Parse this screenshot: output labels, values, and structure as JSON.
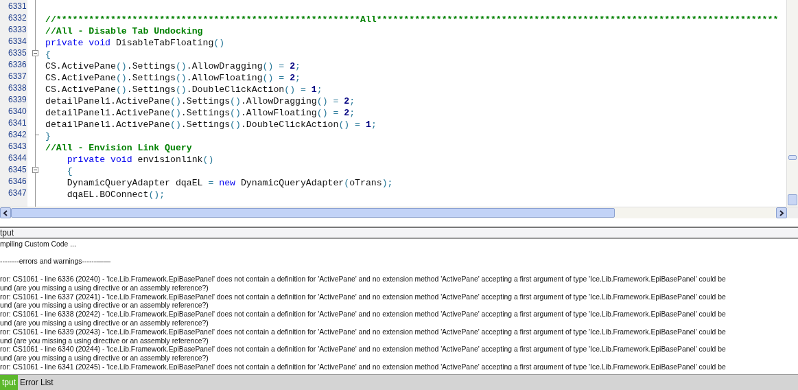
{
  "editor": {
    "lines": [
      {
        "number": "6331",
        "kind": "plain"
      },
      {
        "number": "6332",
        "kind": "plain",
        "tokens": [
          {
            "kind": "comment",
            "text": "//********************************************************All**************************************************************************"
          }
        ]
      },
      {
        "number": "6333",
        "kind": "plain",
        "tokens": [
          {
            "kind": "comment",
            "text": "//All - Disable Tab Undocking"
          }
        ]
      },
      {
        "number": "6334",
        "kind": "plain",
        "tokens": [
          {
            "kind": "keyword",
            "text": "private void "
          },
          {
            "kind": "plain",
            "text": "DisableTabFloating"
          },
          {
            "kind": "punct",
            "text": "()"
          }
        ]
      },
      {
        "number": "6335",
        "kind": "fold-start",
        "tokens": [
          {
            "kind": "punct",
            "text": "{"
          }
        ]
      },
      {
        "number": "6336",
        "kind": "plain",
        "tokens": [
          {
            "kind": "plain",
            "text": "CS.ActivePane"
          },
          {
            "kind": "punct",
            "text": "()"
          },
          {
            "kind": "plain",
            "text": ".Settings"
          },
          {
            "kind": "punct",
            "text": "()"
          },
          {
            "kind": "plain",
            "text": ".AllowDragging"
          },
          {
            "kind": "punct",
            "text": "() = "
          },
          {
            "kind": "number",
            "text": "2"
          },
          {
            "kind": "punct",
            "text": ";"
          }
        ]
      },
      {
        "number": "6337",
        "kind": "plain",
        "tokens": [
          {
            "kind": "plain",
            "text": "CS.ActivePane"
          },
          {
            "kind": "punct",
            "text": "()"
          },
          {
            "kind": "plain",
            "text": ".Settings"
          },
          {
            "kind": "punct",
            "text": "()"
          },
          {
            "kind": "plain",
            "text": ".AllowFloating"
          },
          {
            "kind": "punct",
            "text": "() = "
          },
          {
            "kind": "number",
            "text": "2"
          },
          {
            "kind": "punct",
            "text": ";"
          }
        ]
      },
      {
        "number": "6338",
        "kind": "plain",
        "tokens": [
          {
            "kind": "plain",
            "text": "CS.ActivePane"
          },
          {
            "kind": "punct",
            "text": "()"
          },
          {
            "kind": "plain",
            "text": ".Settings"
          },
          {
            "kind": "punct",
            "text": "()"
          },
          {
            "kind": "plain",
            "text": ".DoubleClickAction"
          },
          {
            "kind": "punct",
            "text": "() = "
          },
          {
            "kind": "number",
            "text": "1"
          },
          {
            "kind": "punct",
            "text": ";"
          }
        ]
      },
      {
        "number": "6339",
        "kind": "plain",
        "tokens": [
          {
            "kind": "plain",
            "text": "detailPanel1.ActivePane"
          },
          {
            "kind": "punct",
            "text": "()"
          },
          {
            "kind": "plain",
            "text": ".Settings"
          },
          {
            "kind": "punct",
            "text": "()"
          },
          {
            "kind": "plain",
            "text": ".AllowDragging"
          },
          {
            "kind": "punct",
            "text": "() = "
          },
          {
            "kind": "number",
            "text": "2"
          },
          {
            "kind": "punct",
            "text": ";"
          }
        ]
      },
      {
        "number": "6340",
        "kind": "plain",
        "tokens": [
          {
            "kind": "plain",
            "text": "detailPanel1.ActivePane"
          },
          {
            "kind": "punct",
            "text": "()"
          },
          {
            "kind": "plain",
            "text": ".Settings"
          },
          {
            "kind": "punct",
            "text": "()"
          },
          {
            "kind": "plain",
            "text": ".AllowFloating"
          },
          {
            "kind": "punct",
            "text": "() = "
          },
          {
            "kind": "number",
            "text": "2"
          },
          {
            "kind": "punct",
            "text": ";"
          }
        ]
      },
      {
        "number": "6341",
        "kind": "plain",
        "tokens": [
          {
            "kind": "plain",
            "text": "detailPanel1.ActivePane"
          },
          {
            "kind": "punct",
            "text": "()"
          },
          {
            "kind": "plain",
            "text": ".Settings"
          },
          {
            "kind": "punct",
            "text": "()"
          },
          {
            "kind": "plain",
            "text": ".DoubleClickAction"
          },
          {
            "kind": "punct",
            "text": "() = "
          },
          {
            "kind": "number",
            "text": "1"
          },
          {
            "kind": "punct",
            "text": ";"
          }
        ]
      },
      {
        "number": "6342",
        "kind": "fold-end",
        "tokens": [
          {
            "kind": "punct",
            "text": "}"
          }
        ]
      },
      {
        "number": "6343",
        "kind": "plain",
        "tokens": [
          {
            "kind": "comment",
            "text": "//All - Envision Link Query"
          }
        ]
      },
      {
        "number": "6344",
        "kind": "plain",
        "tokens": [
          {
            "kind": "keyword",
            "text": "    private void "
          },
          {
            "kind": "plain",
            "text": "envisionlink"
          },
          {
            "kind": "punct",
            "text": "()"
          }
        ]
      },
      {
        "number": "6345",
        "kind": "fold-start",
        "tokens": [
          {
            "kind": "punct",
            "text": "    {"
          }
        ]
      },
      {
        "number": "6346",
        "kind": "plain",
        "tokens": [
          {
            "kind": "plain",
            "text": "    DynamicQueryAdapter dqaEL "
          },
          {
            "kind": "punct",
            "text": "= "
          },
          {
            "kind": "keyword",
            "text": "new "
          },
          {
            "kind": "plain",
            "text": "DynamicQueryAdapter"
          },
          {
            "kind": "punct",
            "text": "("
          },
          {
            "kind": "plain",
            "text": "oTrans"
          },
          {
            "kind": "punct",
            "text": ");"
          }
        ]
      },
      {
        "number": "6347",
        "kind": "plain",
        "tokens": [
          {
            "kind": "plain",
            "text": "    dqaEL.BOConnect"
          },
          {
            "kind": "punct",
            "text": "();"
          }
        ]
      }
    ]
  },
  "output": {
    "title": "tput",
    "status": "mpiling Custom Code ...",
    "heading": "--------errors and warnings------——",
    "lines": [
      "ror: CS1061 - line 6336 (20240) - 'Ice.Lib.Framework.EpiBasePanel' does not contain a definition for 'ActivePane' and no extension method 'ActivePane' accepting a first argument of type 'Ice.Lib.Framework.EpiBasePanel' could be",
      "und (are you missing a using directive or an assembly reference?)",
      "ror: CS1061 - line 6337 (20241) - 'Ice.Lib.Framework.EpiBasePanel' does not contain a definition for 'ActivePane' and no extension method 'ActivePane' accepting a first argument of type 'Ice.Lib.Framework.EpiBasePanel' could be",
      "und (are you missing a using directive or an assembly reference?)",
      "ror: CS1061 - line 6338 (20242) - 'Ice.Lib.Framework.EpiBasePanel' does not contain a definition for 'ActivePane' and no extension method 'ActivePane' accepting a first argument of type 'Ice.Lib.Framework.EpiBasePanel' could be",
      "und (are you missing a using directive or an assembly reference?)",
      "ror: CS1061 - line 6339 (20243) - 'Ice.Lib.Framework.EpiBasePanel' does not contain a definition for 'ActivePane' and no extension method 'ActivePane' accepting a first argument of type 'Ice.Lib.Framework.EpiBasePanel' could be",
      "und (are you missing a using directive or an assembly reference?)",
      "ror: CS1061 - line 6340 (20244) - 'Ice.Lib.Framework.EpiBasePanel' does not contain a definition for 'ActivePane' and no extension method 'ActivePane' accepting a first argument of type 'Ice.Lib.Framework.EpiBasePanel' could be",
      "und (are you missing a using directive or an assembly reference?)",
      "ror: CS1061 - line 6341 (20245) - 'Ice.Lib.Framework.EpiBasePanel' does not contain a definition for 'ActivePane' and no extension method 'ActivePane' accepting a first argument of type 'Ice.Lib.Framework.EpiBasePanel' could be"
    ]
  },
  "tabs": [
    {
      "label": "tput",
      "selected": true
    },
    {
      "label": "Error List",
      "selected": false
    }
  ]
}
